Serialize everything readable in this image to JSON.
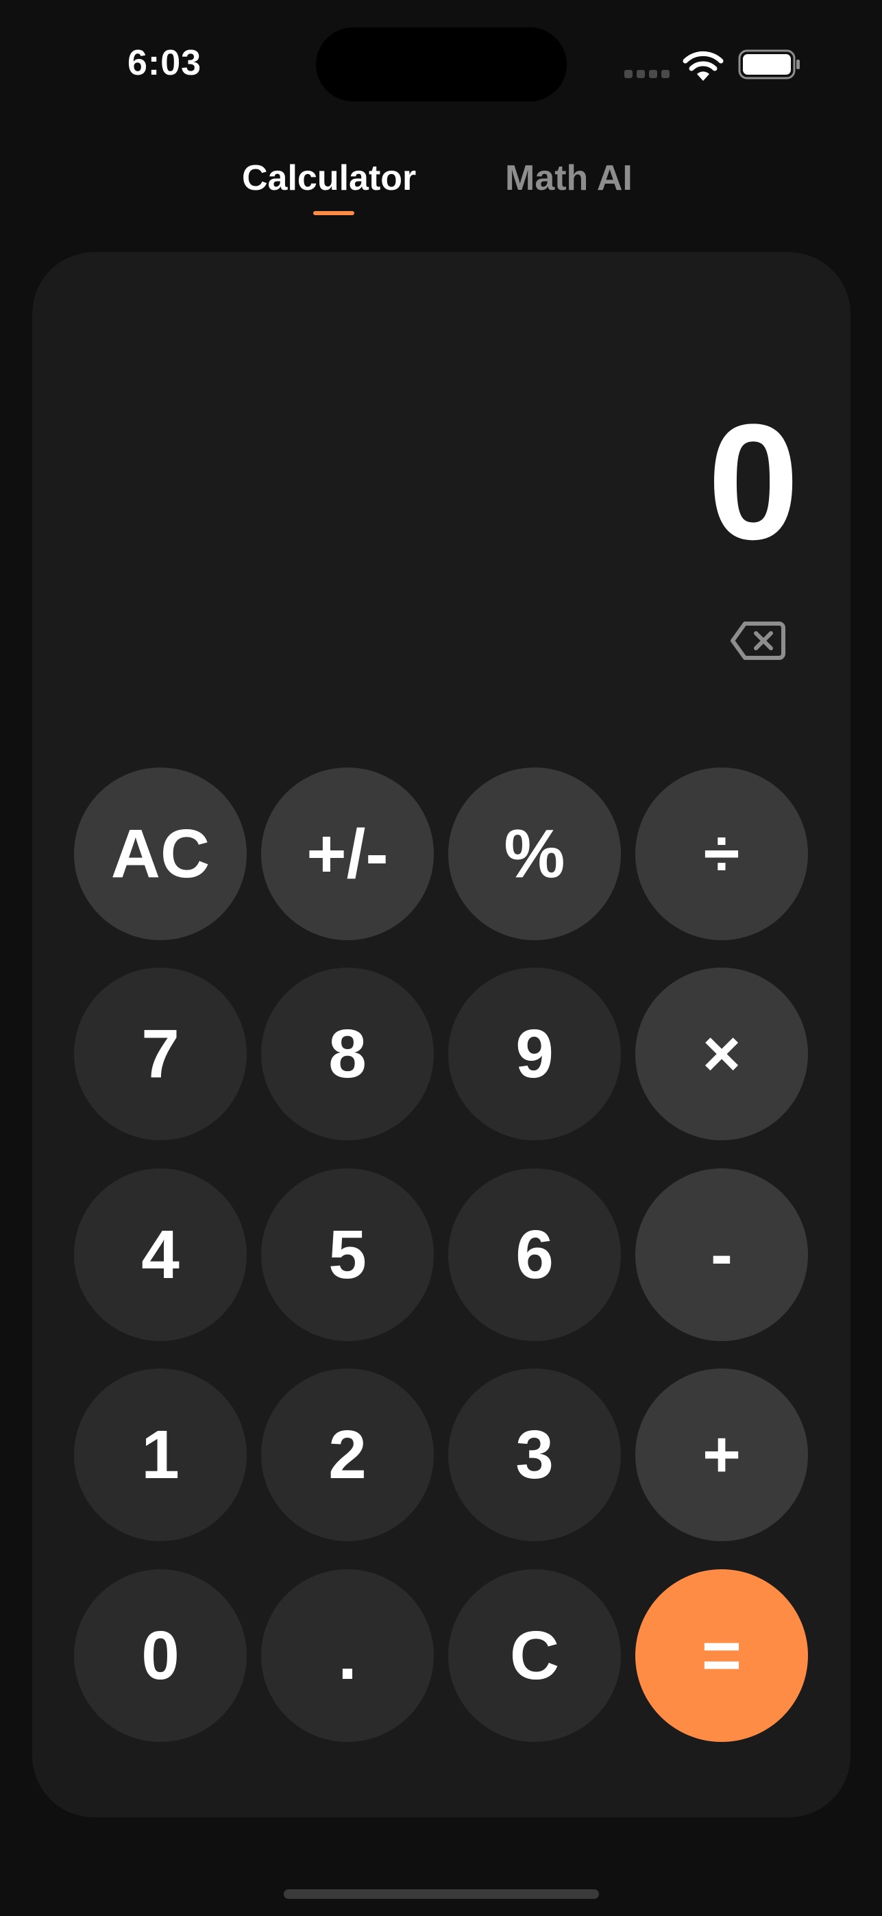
{
  "status_bar": {
    "time": "6:03"
  },
  "tabs": [
    {
      "label": "Calculator",
      "active": true
    },
    {
      "label": "Math AI",
      "active": false
    }
  ],
  "display": {
    "value": "0"
  },
  "keypad": {
    "rows": [
      [
        "AC",
        "+/-",
        "%",
        "÷"
      ],
      [
        "7",
        "8",
        "9",
        "×"
      ],
      [
        "4",
        "5",
        "6",
        "-"
      ],
      [
        "1",
        "2",
        "3",
        "+"
      ],
      [
        "0",
        ".",
        "C",
        "="
      ]
    ]
  },
  "colors": {
    "accent": "#fe8c45",
    "background": "#0f0f0f",
    "card": "#1b1b1b",
    "number_key": "#2b2b2b",
    "operator_key": "#3a3a3a"
  },
  "icons": {
    "backspace": "backspace-icon",
    "wifi": "wifi-icon",
    "battery": "battery-icon",
    "signal": "signal-icon"
  }
}
